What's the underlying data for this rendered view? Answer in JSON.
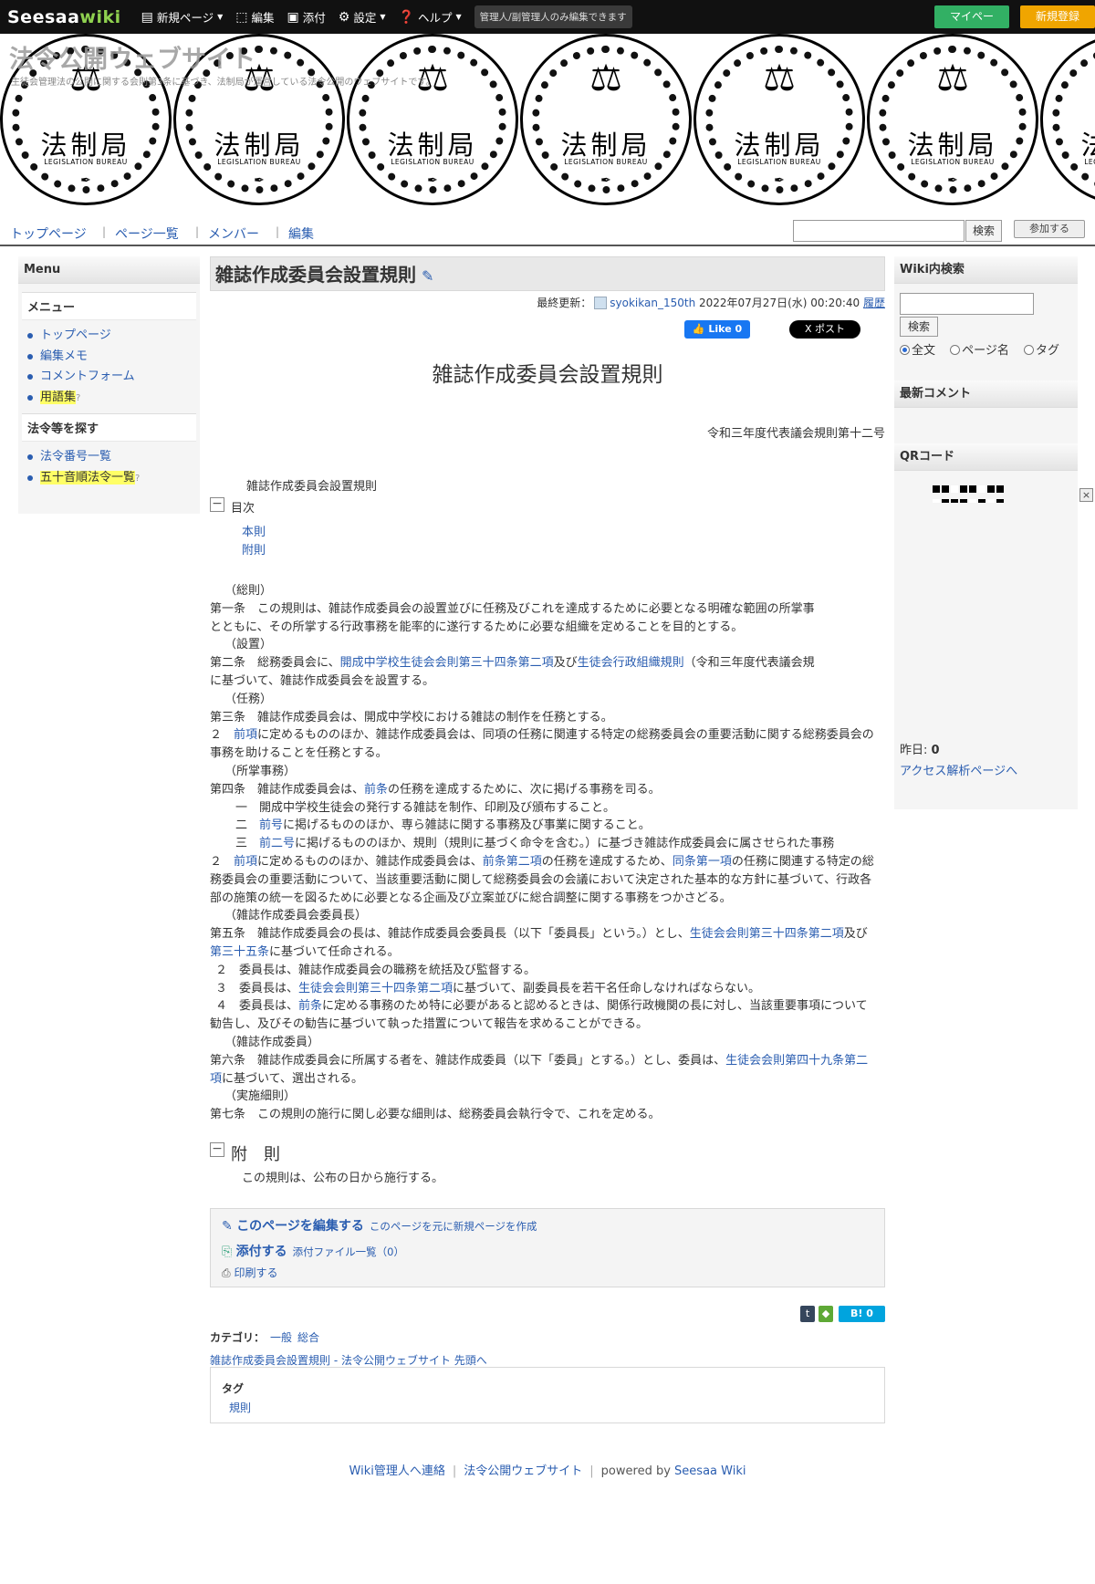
{
  "topbar": {
    "logo_main": "Seesaa",
    "logo_wiki": "wiki",
    "items": [
      {
        "icon": "document-icon",
        "label": "新規ページ",
        "dropdown": true
      },
      {
        "icon": "edit-icon",
        "label": "編集",
        "dropdown": false
      },
      {
        "icon": "image-icon",
        "label": "添付",
        "dropdown": false
      },
      {
        "icon": "gear-icon",
        "label": "設定",
        "dropdown": true
      },
      {
        "icon": "help-icon",
        "label": "ヘルプ",
        "dropdown": true
      }
    ],
    "notice": "管理人/副管理人のみ編集できます",
    "mypage": "マイページ",
    "register": "新規登録",
    "colors": {
      "mypage": "#32b064",
      "register": "#f0a500"
    }
  },
  "banner": {
    "site_title": "法令公開ウェブサイト",
    "site_desc": "生徒会管理法の公開に関する会則第3条に基づき、法制局が運営している法令公開のウェブサイトです。",
    "seal_kanji": "法制局",
    "seal_english": "LEGISLATION BUREAU"
  },
  "nav": {
    "links": [
      "トップページ",
      "ページ一覧",
      "メンバー",
      "編集"
    ],
    "search_button": "検索",
    "join_button": "参加する"
  },
  "left_sidebar": {
    "header": "Menu",
    "sections": [
      {
        "title": "メニュー",
        "items": [
          {
            "label": "トップページ",
            "highlight": false
          },
          {
            "label": "編集メモ",
            "highlight": false
          },
          {
            "label": "コメントフォーム",
            "highlight": false
          },
          {
            "label": "用語集",
            "highlight": true,
            "suffix": "?"
          }
        ]
      },
      {
        "title": "法令等を探す",
        "items": [
          {
            "label": "法令番号一覧",
            "highlight": false
          },
          {
            "label": "五十音順法令一覧",
            "highlight": true,
            "suffix": "?"
          }
        ]
      }
    ]
  },
  "right_sidebar": {
    "search_header": "Wiki内検索",
    "search_button": "検索",
    "radio_options": [
      "全文",
      "ページ名",
      "タグ"
    ],
    "radio_selected": "全文",
    "recent_comments_header": "最新コメント",
    "qr_header": "QRコード",
    "yesterday_label": "昨日:",
    "yesterday_value": "0",
    "access_link": "アクセス解析ページへ",
    "close_glyph": "×"
  },
  "page": {
    "title": "雑誌作成委員会設置規則",
    "updated_label": "最終更新：",
    "updated_user": "syokikan_150th",
    "updated_time": "2022年07月27日(水) 00:20:40",
    "history_link": "履歴",
    "fb_like": "Like 0",
    "x_post": "X ポスト",
    "doc_title": "雑誌作成委員会設置規則",
    "law_number": "令和三年度代表議会規則第十二号",
    "law_name": "雑誌作成委員会設置規則",
    "toc_label": "目次",
    "toc_links": [
      "本則",
      "附則"
    ],
    "articles": [
      "（総則）",
      "第一条　この規則は、雑誌作成委員会の設置並びに任務及びこれを達成するために必要となる明確な範囲の所掌事",
      "とともに、その所掌する行政事務を能率的に遂行するために必要な組織を定めることを目的とする。",
      "（設置）",
      "第二条　総務委員会に、",
      "開成中学校生徒会会則第三十四条第二項",
      "及び",
      "生徒会行政組織規則",
      "（令和三年度代表議会規",
      "に基づいて、雑誌作成委員会を設置する。",
      "（任務）",
      "第三条　雑誌作成委員会は、開成中学校における雑誌の制作を任務とする。",
      "２　",
      "前項",
      "に定めるもののほか、雑誌作成委員会は、同項の任務に関連する特定の総務委員会の重要活動に関する総務委員会の",
      "事務を助けることを任務とする。",
      "（所掌事務）",
      "第四条　雑誌作成委員会は、",
      "前条",
      "の任務を達成するために、次に掲げる事務を司る。",
      "一　開成中学校生徒会の発行する雑誌を制作、印刷及び頒布すること。",
      "二　",
      "前号",
      "に掲げるもののほか、専ら雑誌に関する事務及び事業に関すること。",
      "三　",
      "前二号",
      "に掲げるもののほか、規則（規則に基づく命令を含む。）に基づき雑誌作成委員会に属させられた事務",
      "２　",
      "前項",
      "に定めるもののほか、雑誌作成委員会は、",
      "前条第二項",
      "の任務を達成するため、",
      "同条第一項",
      "の任務に関連する特定の総",
      "務委員会の重要活動について、当該重要活動に関して総務委員会の会議において決定された基本的な方針に基づいて、行政各",
      "部の施策の統一を図るために必要となる企画及び立案並びに総合調整に関する事務をつかさどる。",
      "（雑誌作成委員会委員長）",
      "第五条　雑誌作成委員会の長は、雑誌作成委員会委員長（以下「委員長」という。）とし、",
      "生徒会会則第三十四条第二項",
      "及び",
      "第三十五条",
      "に基づいて任命される。",
      "２　委員長は、雑誌作成委員会の職務を統括及び監督する。",
      "３　委員長は、",
      "生徒会会則第三十四条第二項",
      "に基づいて、副委員長を若干名任命しなければならない。",
      "４　委員長は、",
      "前条",
      "に定める事務のため特に必要があると認めるときは、関係行政機関の長に対し、当該重要事項について",
      "勧告し、及びその勧告に基づいて執った措置について報告を求めることができる。",
      "（雑誌作成委員）",
      "第六条　雑誌作成委員会に所属する者を、雑誌作成委員（以下「委員」とする。）とし、委員は、",
      "生徒会会則第四十九条第二",
      "項",
      "に基づいて、選出される。",
      "（実施細則）",
      "第七条　この規則の施行に関し必要な細則は、総務委員会執行令で、これを定める。"
    ],
    "furoku_title": "附　則",
    "furoku_text": "この規則は、公布の日から施行する。",
    "edit_page": "このページを編集する",
    "new_from_page": "このページを元に新規ページを作成",
    "attach": "添付する",
    "attach_list": "添付ファイル一覧（0）",
    "print": "印刷する",
    "share_t": "t",
    "share_hatena": "B! 0",
    "category_label": "カテゴリ：",
    "categories": [
      "一般",
      "総合"
    ],
    "breadcrumb": "雑誌作成委員会設置規則 - 法令公開ウェブサイト 先頭へ",
    "tag_label": "タグ",
    "tags": [
      "規則"
    ]
  },
  "footer": {
    "contact": "Wiki管理人へ連絡",
    "site": "法令公開ウェブサイト",
    "powered": "powered by",
    "seesaa": "Seesaa Wiki"
  }
}
